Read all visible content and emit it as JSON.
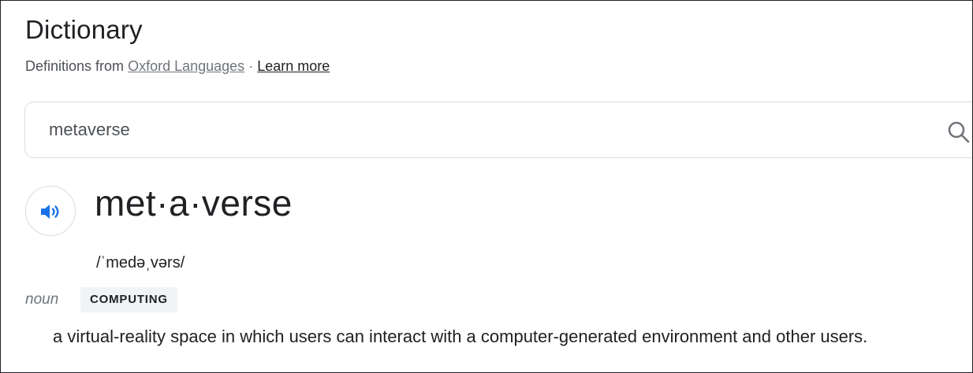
{
  "header": {
    "title": "Dictionary",
    "source_prefix": "Definitions from",
    "source_link": "Oxford Languages",
    "separator": "·",
    "learn_more": "Learn more"
  },
  "search": {
    "value": "metaverse",
    "icon": "search-icon"
  },
  "entry": {
    "audio_icon": "speaker-icon",
    "headword": "met·a·verse",
    "phonetic": "/ˈmedəˌvərs/",
    "part_of_speech": "noun",
    "label": "COMPUTING",
    "definition": "a virtual-reality space in which users can interact with a computer-generated environment and other users."
  },
  "colors": {
    "accent_blue": "#1a73e8",
    "text": "#202124",
    "muted": "#70757a"
  }
}
